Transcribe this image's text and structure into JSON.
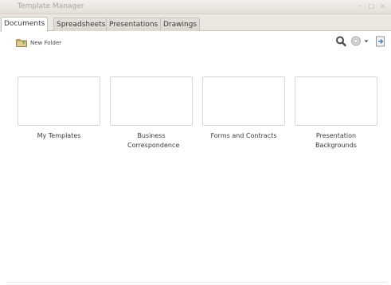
{
  "window": {
    "title": "Template Manager"
  },
  "tabs": [
    {
      "label": "Documents",
      "active": true
    },
    {
      "label": "Spreadsheets",
      "active": false
    },
    {
      "label": "Presentations",
      "active": false
    },
    {
      "label": "Drawings",
      "active": false
    }
  ],
  "toolbar": {
    "new_folder_label": "New Folder",
    "icons": [
      "search-icon",
      "settings-icon",
      "dropdown-icon",
      "import-icon"
    ]
  },
  "folders": [
    {
      "label": "My Templates"
    },
    {
      "label": "Business Correspondence"
    },
    {
      "label": "Forms and Contracts"
    },
    {
      "label": "Presentation Backgrounds"
    }
  ],
  "colors": {
    "titlebar_bg": "#e9e6e0",
    "tabbar_bg": "#ebe8e2",
    "content_bg": "#ffffff",
    "thumb_border": "#d7d7d7"
  }
}
